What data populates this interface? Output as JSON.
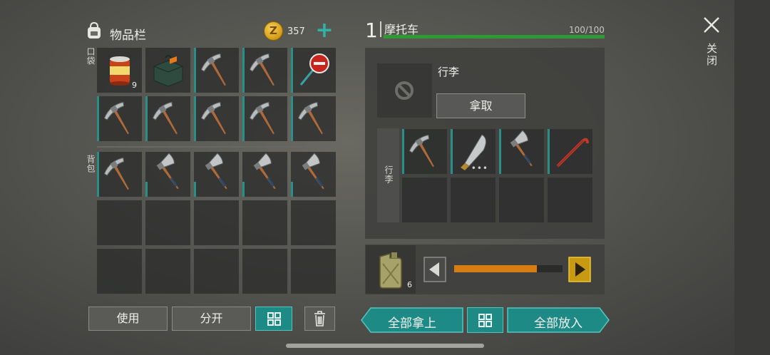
{
  "inventory": {
    "title": "物品栏",
    "coins": "357",
    "pocket_label": "口袋",
    "backpack_label": "背包",
    "pocket_slots": [
      {
        "item": "food-can",
        "qty": "9"
      },
      {
        "item": "supply-bag",
        "qty": ""
      },
      {
        "item": "pickaxe",
        "qty": ""
      },
      {
        "item": "pickaxe",
        "qty": ""
      },
      {
        "item": "stop-sign",
        "qty": ""
      },
      {
        "item": "pickaxe",
        "qty": ""
      },
      {
        "item": "pickaxe",
        "qty": ""
      },
      {
        "item": "pickaxe",
        "qty": ""
      },
      {
        "item": "pickaxe",
        "qty": ""
      },
      {
        "item": "pickaxe",
        "qty": ""
      }
    ],
    "backpack_slots": [
      {
        "item": "pickaxe",
        "qty": ""
      },
      {
        "item": "hatchet",
        "qty": ""
      },
      {
        "item": "hatchet",
        "qty": ""
      },
      {
        "item": "hatchet",
        "qty": ""
      },
      {
        "item": "hatchet",
        "qty": ""
      }
    ],
    "use_label": "使用",
    "split_label": "分开"
  },
  "vehicle": {
    "number": "1",
    "name": "摩托车",
    "hp_text": "100/100",
    "hp": 1.0,
    "luggage_label": "行李",
    "take_label": "拿取",
    "luggage_side_label": "行李",
    "luggage_slots": [
      {
        "item": "pickaxe"
      },
      {
        "item": "machete"
      },
      {
        "item": "hatchet"
      },
      {
        "item": "crowbar"
      }
    ],
    "fuel_qty": "6",
    "fuel_level": 0.76,
    "take_all_label": "全部拿上",
    "put_all_label": "全部放入"
  },
  "close_label": "关闭",
  "colors": {
    "accent": "#1e8a86",
    "hp": "#2f9a35",
    "fuel": "#d77d14"
  }
}
